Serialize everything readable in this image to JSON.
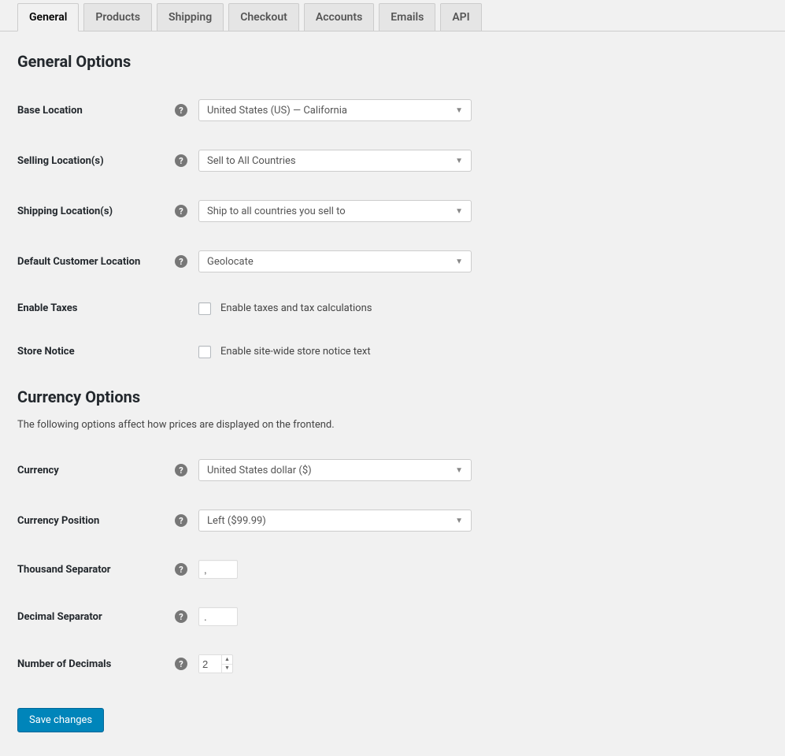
{
  "tabs": [
    {
      "label": "General",
      "active": true
    },
    {
      "label": "Products"
    },
    {
      "label": "Shipping"
    },
    {
      "label": "Checkout"
    },
    {
      "label": "Accounts"
    },
    {
      "label": "Emails"
    },
    {
      "label": "API"
    }
  ],
  "general_section": {
    "title": "General Options",
    "rows": {
      "base_location": {
        "label": "Base Location",
        "value": "United States (US) — California"
      },
      "selling_locations": {
        "label": "Selling Location(s)",
        "value": "Sell to All Countries"
      },
      "shipping_locations": {
        "label": "Shipping Location(s)",
        "value": "Ship to all countries you sell to"
      },
      "default_customer_location": {
        "label": "Default Customer Location",
        "value": "Geolocate"
      },
      "enable_taxes": {
        "label": "Enable Taxes",
        "checkbox_label": "Enable taxes and tax calculations"
      },
      "store_notice": {
        "label": "Store Notice",
        "checkbox_label": "Enable site-wide store notice text"
      }
    }
  },
  "currency_section": {
    "title": "Currency Options",
    "desc": "The following options affect how prices are displayed on the frontend.",
    "rows": {
      "currency": {
        "label": "Currency",
        "value": "United States dollar ($)"
      },
      "currency_position": {
        "label": "Currency Position",
        "value": "Left ($99.99)"
      },
      "thousand_separator": {
        "label": "Thousand Separator",
        "value": ","
      },
      "decimal_separator": {
        "label": "Decimal Separator",
        "value": "."
      },
      "number_of_decimals": {
        "label": "Number of Decimals",
        "value": "2"
      }
    }
  },
  "save_button": "Save changes",
  "help_glyph": "?"
}
